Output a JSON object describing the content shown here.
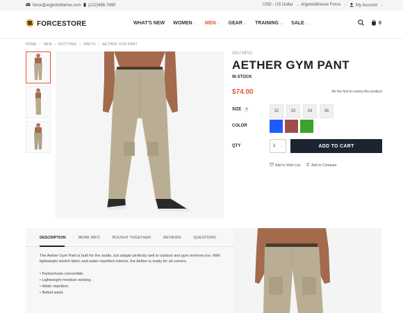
{
  "topbar": {
    "email": "force@argentotheme.com",
    "phone": "(212)456-7890",
    "currency": "USD - US Dollar",
    "store": "ArgentoBreeze Force",
    "account": "My Account"
  },
  "header": {
    "logo_text": "FORCESTORE",
    "nav": [
      "WHAT'S NEW",
      "WOMEN",
      "MEN",
      "GEAR",
      "TRAINING",
      "SALE"
    ],
    "cart_count": "0",
    "accent_color": "#e2572b"
  },
  "breadcrumb": [
    "HOME",
    "MEN",
    "BOTTOMS",
    "PANTS",
    "AETHER GYM PANT"
  ],
  "product": {
    "sku": "SKU MP11",
    "title": "AETHER GYM PANT",
    "stock": "IN STOCK",
    "price": "$74.00",
    "review_link": "Be the first to review this product",
    "size_label": "SIZE",
    "sizes": [
      "32",
      "33",
      "34",
      "36"
    ],
    "color_label": "COLOR",
    "colors": [
      "#1e5bff",
      "#9c4f4a",
      "#3aa329"
    ],
    "qty_label": "QTY",
    "qty_value": "1",
    "add_to_cart": "ADD TO CART",
    "wishlist": "Add to Wish List",
    "compare": "Add to Compare"
  },
  "tabs": {
    "items": [
      "DESCRIPTION",
      "MORE INFO",
      "BOUGHT TOGETHER",
      "REVIEWS",
      "QUESTIONS"
    ],
    "description": "The Aether Gym Pant is built for the studio, but adapts perfectly well to outdoor and gym environs too. With lightweight stretch fabric and water-repellent exterior, the Aether is ready for all comers.",
    "bullets": [
      "Pants/shorts convertible.",
      "Lightweight moisture wicking.",
      "Water repellent.",
      "Belted waist."
    ]
  }
}
